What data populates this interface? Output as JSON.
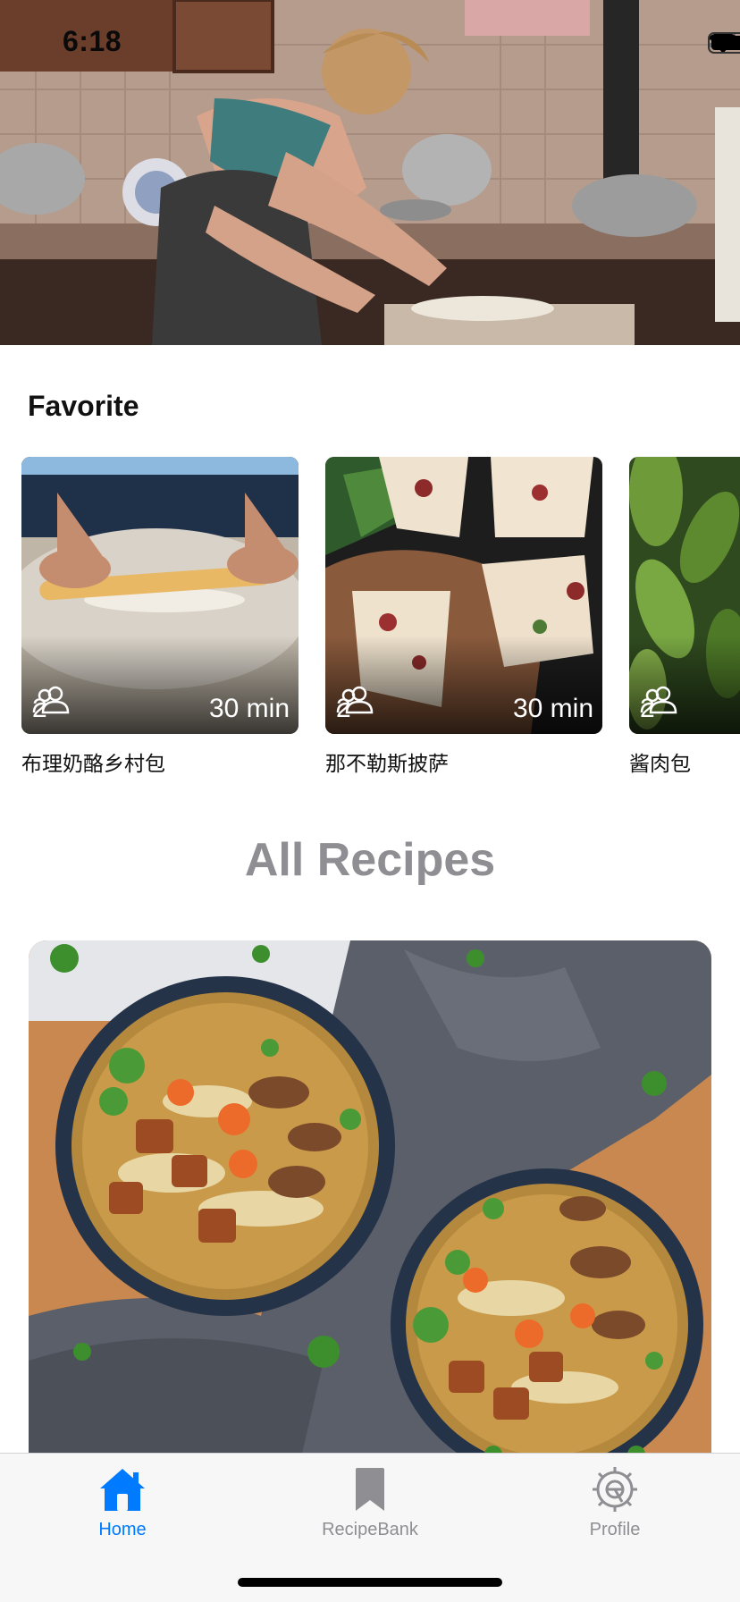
{
  "status_bar": {
    "time": "6:18",
    "icons": [
      "signal-icon",
      "wifi-icon",
      "battery-icon"
    ]
  },
  "hero": {
    "image": "woman-rolling-dough-in-kitchen-photo"
  },
  "favorite": {
    "title": "Favorite",
    "items": [
      {
        "name": "布理奶酪乡村包",
        "servings": "2",
        "time": "30 min",
        "image": "rolling-pin-dough-photo"
      },
      {
        "name": "那不勒斯披萨",
        "servings": "2",
        "time": "30 min",
        "image": "pizza-slices-photo"
      },
      {
        "name": "酱肉包",
        "servings": "2",
        "time": "",
        "image": "green-leaves-photo"
      }
    ]
  },
  "all_recipes": {
    "title": "All Recipes",
    "featured_image": "noodle-soup-bowls-photo"
  },
  "tab_bar": {
    "tabs": [
      {
        "label": "Home",
        "icon": "home-icon",
        "active": true
      },
      {
        "label": "RecipeBank",
        "icon": "bookmark-icon",
        "active": false
      },
      {
        "label": "Profile",
        "icon": "gear-icon",
        "active": false
      }
    ],
    "active_color": "#007aff",
    "inactive_color": "#8e8e93"
  }
}
